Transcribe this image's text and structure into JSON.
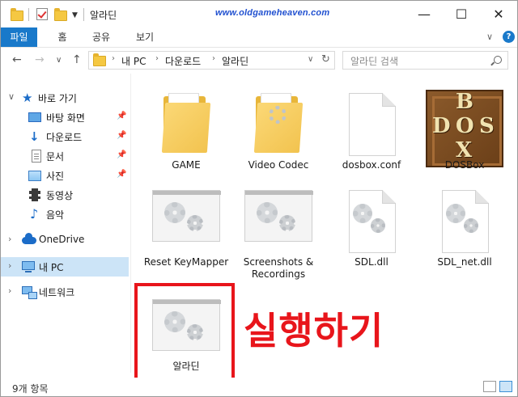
{
  "window": {
    "title": "알라딘",
    "watermark": "www.oldgameheaven.com",
    "controls": {
      "minimize": "—",
      "maximize": "☐",
      "close": "✕"
    }
  },
  "ribbon": {
    "tabs": [
      "파일",
      "홈",
      "공유",
      "보기"
    ],
    "expand": "∨",
    "help": "?"
  },
  "nav": {
    "back": "←",
    "forward": "→",
    "recent": "∨",
    "up": "↑",
    "address": [
      "내 PC",
      "다운로드",
      "알라딘"
    ],
    "address_dropdown": "∨",
    "refresh": "↻",
    "search_placeholder": "알라딘 검색"
  },
  "navpane": {
    "quick_access": "바로 가기",
    "quick_items": [
      {
        "label": "바탕 화면",
        "icon": "desktop-icon",
        "pinned": true
      },
      {
        "label": "다운로드",
        "icon": "download-icon",
        "pinned": true
      },
      {
        "label": "문서",
        "icon": "document-icon",
        "pinned": true
      },
      {
        "label": "사진",
        "icon": "pictures-icon",
        "pinned": true
      },
      {
        "label": "동영상",
        "icon": "videos-icon",
        "pinned": false
      },
      {
        "label": "음악",
        "icon": "music-icon",
        "pinned": false
      }
    ],
    "onedrive": "OneDrive",
    "this_pc": "내 PC",
    "network": "네트워크"
  },
  "files": [
    {
      "name": "GAME",
      "type": "folder"
    },
    {
      "name": "Video Codec",
      "type": "folder"
    },
    {
      "name": "dosbox.conf",
      "type": "file"
    },
    {
      "name": "DOSBox",
      "type": "dosbox"
    },
    {
      "name": "Reset KeyMapper",
      "type": "app"
    },
    {
      "name": "Screenshots & Recordings",
      "type": "app"
    },
    {
      "name": "SDL.dll",
      "type": "dll"
    },
    {
      "name": "SDL_net.dll",
      "type": "dll"
    },
    {
      "name": "알라딘",
      "type": "app"
    }
  ],
  "dosbox_letters": [
    "B",
    "D",
    "O",
    "S",
    "X"
  ],
  "annotation": "실행하기",
  "status": {
    "count": "9개 항목"
  },
  "colors": {
    "accent": "#1979ca",
    "highlight": "#e8151b",
    "selected": "#cce4f7"
  }
}
